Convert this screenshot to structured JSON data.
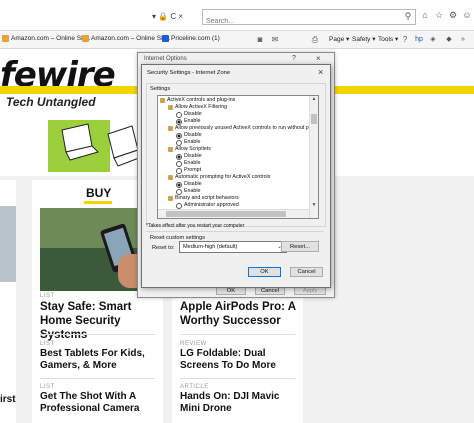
{
  "browser": {
    "address_tail": "▾ 🔒 C ×",
    "search": {
      "placeholder": "Search...",
      "value": ""
    },
    "favorites": [
      {
        "label": "Amazon.com – Online Sh..."
      },
      {
        "label": "Amazon.com – Online Sh..."
      },
      {
        "label": "Priceline.com (1)"
      }
    ],
    "commands": {
      "page": "Page ▾",
      "safety": "Safety ▾",
      "tools": "Tools ▾"
    }
  },
  "site": {
    "logo_text": "fewire",
    "tagline": "Tech Untangled",
    "buy_label": "BUY"
  },
  "articles": {
    "col1_top": {
      "kicker": "LIST",
      "title": "Stay Safe: Smart Home Security Systems"
    },
    "col2_top": {
      "title": "Apple AirPods Pro: A Worthy Successor"
    },
    "col1_mid": {
      "kicker": "LIST",
      "title": "Best Tablets For Kids, Gamers, & More"
    },
    "col2_mid": {
      "kicker": "REVIEW",
      "title": "LG Foldable: Dual Screens To Do More"
    },
    "col1_bot": {
      "kicker": "LIST",
      "title": "Get The Shot With A Professional Camera"
    },
    "col2_bot": {
      "kicker": "ARTICLE",
      "title": "Hands On: DJI Mavic Mini Drone"
    },
    "left_edge_word": "irst"
  },
  "internet_options": {
    "title": "Internet Options",
    "buttons": {
      "ok": "OK",
      "cancel": "Cancel",
      "apply": "Apply"
    }
  },
  "security_settings": {
    "title": "Security Settings - Internet Zone",
    "settings_label": "Settings",
    "rows": [
      {
        "type": "group",
        "text": "ActiveX controls and plug-ins"
      },
      {
        "type": "item",
        "text": "Allow ActiveX Filtering"
      },
      {
        "type": "radio",
        "text": "Disable",
        "checked": false
      },
      {
        "type": "radio",
        "text": "Enable",
        "checked": true
      },
      {
        "type": "item",
        "text": "Allow previously unused ActiveX controls to run without prom"
      },
      {
        "type": "radio",
        "text": "Disable",
        "checked": true
      },
      {
        "type": "radio",
        "text": "Enable",
        "checked": false
      },
      {
        "type": "item",
        "text": "Allow Scriptlets"
      },
      {
        "type": "radio",
        "text": "Disable",
        "checked": true
      },
      {
        "type": "radio",
        "text": "Enable",
        "checked": false
      },
      {
        "type": "radio",
        "text": "Prompt",
        "checked": false
      },
      {
        "type": "item",
        "text": "Automatic prompting for ActiveX controls"
      },
      {
        "type": "radio",
        "text": "Disable",
        "checked": true
      },
      {
        "type": "radio",
        "text": "Enable",
        "checked": false
      },
      {
        "type": "item",
        "text": "Binary and script behaviors"
      },
      {
        "type": "radio",
        "text": "Administrator approved",
        "checked": false
      }
    ],
    "note": "*Takes effect after you restart your computer",
    "reset_group_label": "Reset custom settings",
    "reset_to_label": "Reset to:",
    "reset_level": "Medium-high (default)",
    "reset_button": "Reset...",
    "ok": "OK",
    "cancel": "Cancel"
  },
  "colors": {
    "accent_yellow": "#f3d400",
    "dialog_bg": "#f0f0f0",
    "focus_blue": "#0078d7"
  }
}
